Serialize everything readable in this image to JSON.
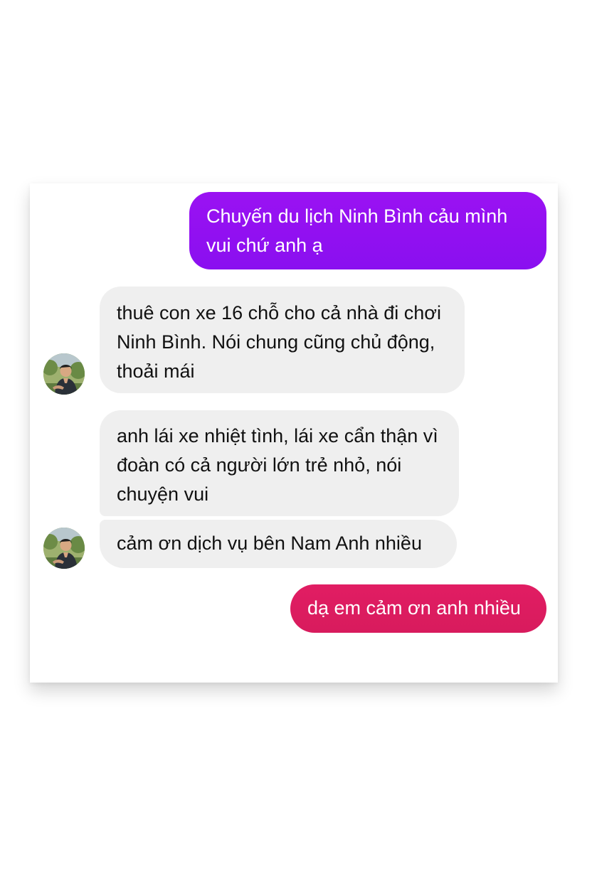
{
  "conversation": {
    "messages": [
      {
        "sender": "me",
        "text": "Chuyến du lịch Ninh Bình cảu mình vui chứ anh ạ",
        "color": "#9410F1"
      },
      {
        "sender": "customer",
        "text": "thuê con xe 16 chỗ cho cả nhà đi chơi Ninh Bình. Nói chung cũng chủ động, thoải mái",
        "color": "#EFEFEF"
      },
      {
        "sender": "customer",
        "text": "anh lái xe nhiệt tình, lái xe cẩn thận vì đoàn có cả người lớn trẻ nhỏ, nói chuyện vui",
        "color": "#EFEFEF"
      },
      {
        "sender": "customer",
        "text": "cảm ơn dịch vụ bên Nam Anh nhiều",
        "color": "#EFEFEF"
      },
      {
        "sender": "me",
        "text": "dạ em cảm ơn anh nhiều",
        "color": "#DC1C60"
      }
    ],
    "avatar_icon": "person-avatar-icon"
  }
}
